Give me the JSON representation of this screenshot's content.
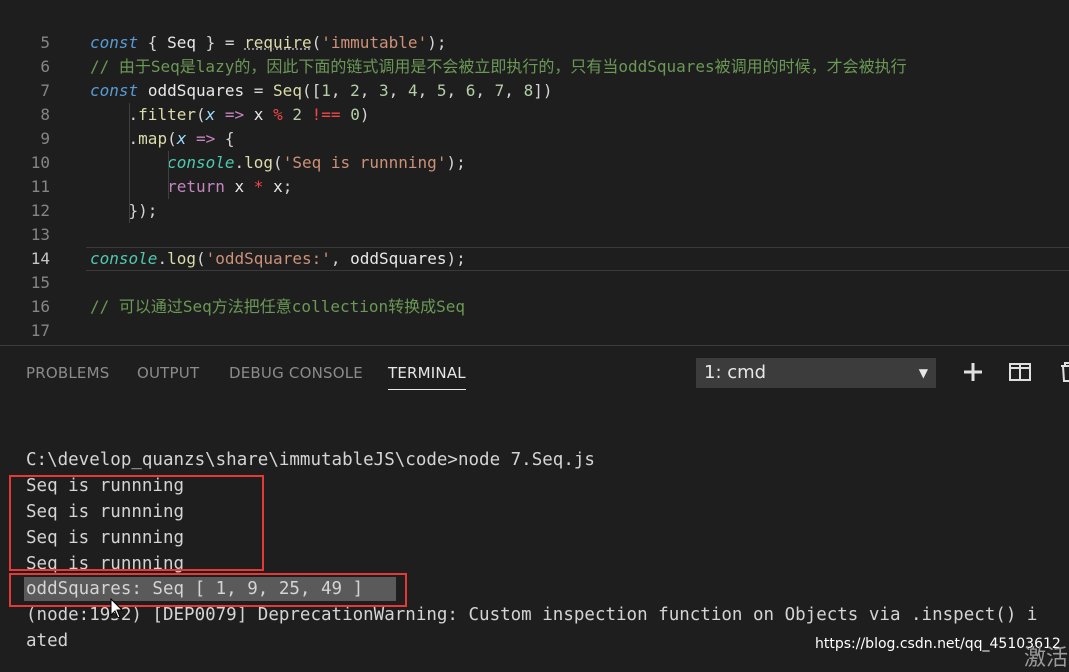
{
  "editor": {
    "lines": [
      {
        "num": "5",
        "tokens": [
          [
            "kw",
            "const"
          ],
          [
            "pun",
            " { "
          ],
          [
            "var",
            "Seq"
          ],
          [
            "pun",
            " } = "
          ],
          [
            "fnu",
            "require"
          ],
          [
            "pun",
            "("
          ],
          [
            "str",
            "'immutable'"
          ],
          [
            "pun",
            ");"
          ]
        ]
      },
      {
        "num": "6",
        "tokens": [
          [
            "cm",
            "// 由于Seq是lazy的，因此下面的链式调用是不会被立即执行的，只有当oddSquares被调用的时候，才会被执行"
          ]
        ]
      },
      {
        "num": "7",
        "tokens": [
          [
            "kw",
            "const"
          ],
          [
            "pun",
            " "
          ],
          [
            "var",
            "oddSquares"
          ],
          [
            "pun",
            " = "
          ],
          [
            "fn",
            "Seq"
          ],
          [
            "pun",
            "(["
          ],
          [
            "num",
            "1"
          ],
          [
            "pun",
            ", "
          ],
          [
            "num",
            "2"
          ],
          [
            "pun",
            ", "
          ],
          [
            "num",
            "3"
          ],
          [
            "pun",
            ", "
          ],
          [
            "num",
            "4"
          ],
          [
            "pun",
            ", "
          ],
          [
            "num",
            "5"
          ],
          [
            "pun",
            ", "
          ],
          [
            "num",
            "6"
          ],
          [
            "pun",
            ", "
          ],
          [
            "num",
            "7"
          ],
          [
            "pun",
            ", "
          ],
          [
            "num",
            "8"
          ],
          [
            "pun",
            "])"
          ]
        ]
      },
      {
        "num": "8",
        "tokens": [
          [
            "pun",
            "    ."
          ],
          [
            "fn",
            "filter"
          ],
          [
            "pun",
            "("
          ],
          [
            "param",
            "x"
          ],
          [
            "pun",
            " "
          ],
          [
            "kw2",
            "=>"
          ],
          [
            "pun",
            " "
          ],
          [
            "var",
            "x"
          ],
          [
            "pun",
            " "
          ],
          [
            "op2",
            "%"
          ],
          [
            "pun",
            " "
          ],
          [
            "num",
            "2"
          ],
          [
            "pun",
            " "
          ],
          [
            "op2",
            "!=="
          ],
          [
            "pun",
            " "
          ],
          [
            "num",
            "0"
          ],
          [
            "pun",
            ")"
          ]
        ]
      },
      {
        "num": "9",
        "tokens": [
          [
            "pun",
            "    ."
          ],
          [
            "fn",
            "map"
          ],
          [
            "pun",
            "("
          ],
          [
            "param",
            "x"
          ],
          [
            "pun",
            " "
          ],
          [
            "kw2",
            "=>"
          ],
          [
            "pun",
            " {"
          ]
        ]
      },
      {
        "num": "10",
        "tokens": [
          [
            "pun",
            "        "
          ],
          [
            "cls",
            "console"
          ],
          [
            "pun",
            "."
          ],
          [
            "fn",
            "log"
          ],
          [
            "pun",
            "("
          ],
          [
            "str",
            "'Seq is runnning'"
          ],
          [
            "pun",
            ");"
          ]
        ]
      },
      {
        "num": "11",
        "tokens": [
          [
            "pun",
            "        "
          ],
          [
            "kw2",
            "return"
          ],
          [
            "pun",
            " "
          ],
          [
            "var",
            "x"
          ],
          [
            "pun",
            " "
          ],
          [
            "op2",
            "*"
          ],
          [
            "pun",
            " "
          ],
          [
            "var",
            "x"
          ],
          [
            "pun",
            ";"
          ]
        ]
      },
      {
        "num": "12",
        "tokens": [
          [
            "pun",
            "    });"
          ]
        ]
      },
      {
        "num": "13",
        "tokens": []
      },
      {
        "num": "14",
        "tokens": [
          [
            "cls",
            "console"
          ],
          [
            "pun",
            "."
          ],
          [
            "fn",
            "log"
          ],
          [
            "pun",
            "("
          ],
          [
            "str",
            "'oddSquares:'"
          ],
          [
            "pun",
            ", "
          ],
          [
            "var",
            "oddSquares"
          ],
          [
            "pun",
            ");"
          ]
        ],
        "current": true
      },
      {
        "num": "15",
        "tokens": []
      },
      {
        "num": "16",
        "tokens": [
          [
            "cm",
            "// 可以通过Seq方法把任意collection转换成Seq"
          ]
        ]
      },
      {
        "num": "17",
        "tokens": []
      }
    ]
  },
  "panel": {
    "tabs": [
      {
        "label": "PROBLEMS",
        "active": false
      },
      {
        "label": "OUTPUT",
        "active": false
      },
      {
        "label": "DEBUG CONSOLE",
        "active": false
      },
      {
        "label": "TERMINAL",
        "active": true
      }
    ],
    "terminal_select": "1: cmd",
    "new_terminal_icon": "plus-icon",
    "split_icon": "split-panel-icon",
    "trash_icon": "trash-icon"
  },
  "terminal": {
    "lines": [
      "C:\\develop_quanzs\\share\\immutableJS\\code>node 7.Seq.js",
      "Seq is runnning",
      "Seq is runnning",
      "Seq is runnning",
      "Seq is runnning",
      "oddSquares: Seq [ 1, 9, 25, 49 ]",
      "(node:1952) [DEP0079] DeprecationWarning: Custom inspection function on Objects via .inspect() i",
      "ated"
    ]
  },
  "watermark": "https://blog.csdn.net/qq_45103612",
  "watermark_overlay": "激活"
}
